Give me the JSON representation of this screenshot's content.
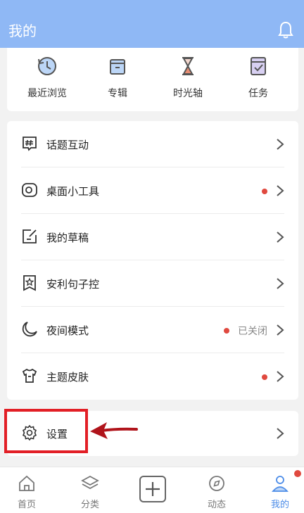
{
  "header": {
    "title": "我的",
    "icon": "bell-icon"
  },
  "quick_actions": [
    {
      "label": "最近浏览",
      "icon": "history-clock-icon"
    },
    {
      "label": "专辑",
      "icon": "album-box-icon"
    },
    {
      "label": "时光轴",
      "icon": "hourglass-icon"
    },
    {
      "label": "任务",
      "icon": "task-checklist-icon"
    }
  ],
  "menu": [
    {
      "label": "话题互动",
      "icon": "topic-hash-icon",
      "dot": false
    },
    {
      "label": "桌面小工具",
      "icon": "widget-icon",
      "dot": true
    },
    {
      "label": "我的草稿",
      "icon": "draft-edit-icon",
      "dot": false
    },
    {
      "label": "安利句子控",
      "icon": "star-bookmark-icon",
      "dot": false
    },
    {
      "label": "夜间模式",
      "icon": "moon-icon",
      "dot": true,
      "status": "已关闭"
    },
    {
      "label": "主题皮肤",
      "icon": "shirt-icon",
      "dot": true
    }
  ],
  "settings": {
    "label": "设置",
    "icon": "gear-icon"
  },
  "tabs": [
    {
      "label": "首页",
      "icon": "home-icon",
      "active": false
    },
    {
      "label": "分类",
      "icon": "layers-icon",
      "active": false
    },
    {
      "label": "",
      "icon": "plus-icon",
      "active": false
    },
    {
      "label": "动态",
      "icon": "compass-icon",
      "active": false
    },
    {
      "label": "我的",
      "icon": "user-icon",
      "active": true
    }
  ],
  "colors": {
    "header_bg": "#8fb8f5",
    "accent": "#4c8ce8",
    "dot": "#e0493f",
    "highlight": "#e21f26"
  }
}
